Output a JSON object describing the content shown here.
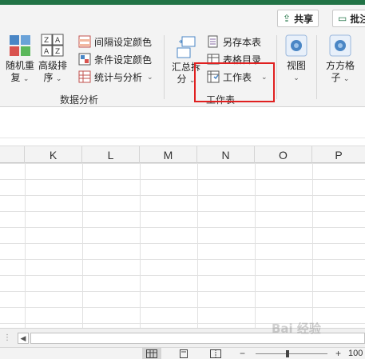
{
  "colors": {
    "accent": "#217346",
    "highlight_box": "#e02020"
  },
  "header": {
    "share_label": "共享",
    "comments_label": "批注"
  },
  "ribbon": {
    "random_sort": {
      "line1": "随机重",
      "line2": "复"
    },
    "advanced_sort": {
      "line1": "高级排",
      "line2": "序"
    },
    "interval_color": "间隔设定颜色",
    "condition_color": "条件设定颜色",
    "stats_analysis": "统计与分析",
    "data_analysis_group": "数据分析",
    "summary_split": {
      "line1": "汇总拆",
      "line2": "分"
    },
    "save_as": "另存本表",
    "table_directory": "表格目录",
    "worksheet": "工作表",
    "worksheet_group": "工作表",
    "view": "视图",
    "fangfang_grid": {
      "line1": "方方格",
      "line2": "子"
    }
  },
  "columns": [
    "K",
    "L",
    "M",
    "N",
    "O",
    "P"
  ],
  "watermark": "Bai 经验"
}
